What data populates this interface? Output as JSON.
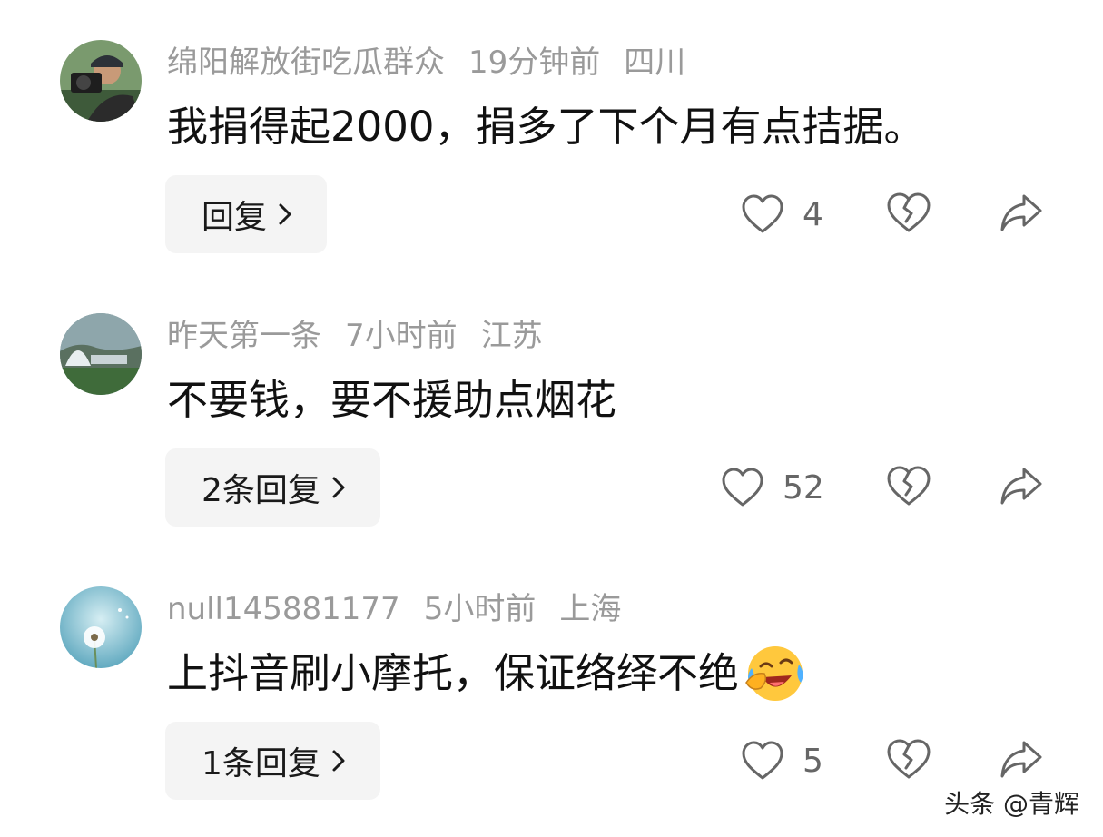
{
  "comments": [
    {
      "username": "绵阳解放街吃瓜群众",
      "time": "19分钟前",
      "location": "四川",
      "text": "我捐得起2000，捐多了下个月有点拮据。",
      "reply_label": "回复",
      "like_count": "4",
      "avatar_icon": "photographer-avatar-icon"
    },
    {
      "username": "昨天第一条",
      "time": "7小时前",
      "location": "江苏",
      "text": "不要钱，要不援助点烟花",
      "reply_label": "2条回复",
      "like_count": "52",
      "avatar_icon": "landscape-avatar-icon"
    },
    {
      "username": "null145881177",
      "time": "5小时前",
      "location": "上海",
      "text": "上抖音刷小摩托，保证络绎不绝",
      "emoji": "laughing-crying-emoji",
      "reply_label": "1条回复",
      "like_count": "5",
      "avatar_icon": "dandelion-avatar-icon"
    }
  ],
  "watermark": "头条 @青辉",
  "colors": {
    "meta_text": "#9a9a9a",
    "reply_bg": "#f4f4f4",
    "icon_stroke": "#666666"
  }
}
